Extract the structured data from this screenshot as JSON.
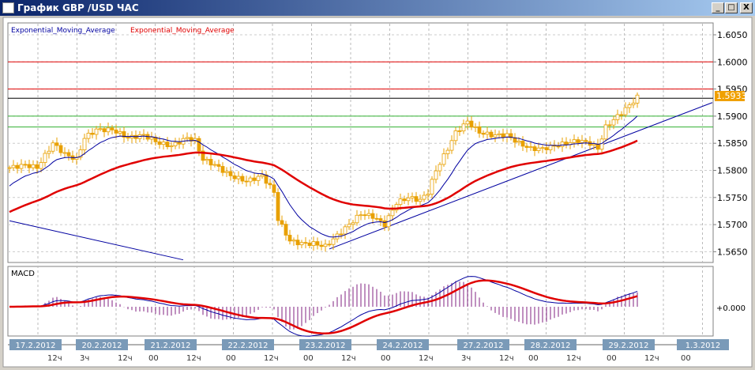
{
  "window": {
    "title": "График GBP /USD  ЧАС",
    "buttons": {
      "minimize": "_",
      "maximize": "□",
      "close": "X"
    }
  },
  "legend": {
    "ema_fast": "Exponential_Moving_Average",
    "ema_slow": "Exponential_Moving_Average"
  },
  "macd_label": "MACD",
  "macd_zero_label": "+0.000",
  "current_price": "1.5933",
  "colors": {
    "candle": "#e8a000",
    "ema_fast": "#0000a0",
    "ema_slow": "#e00000",
    "price_tag": "#f0a000",
    "date_label": "#7a9ab8"
  },
  "chart_data": {
    "type": "candlestick",
    "title": "График GBP /USD  ЧАС",
    "y_ticks": [
      "1.6050",
      "1.6000",
      "1.5950",
      "1.5900",
      "1.5850",
      "1.5800",
      "1.5750",
      "1.5700",
      "1.5650"
    ],
    "ylim": [
      1.5635,
      1.6065
    ],
    "closes_anchor_bar": [
      0,
      4,
      7,
      11,
      14,
      17,
      19,
      22,
      26,
      30,
      34,
      38,
      41,
      45,
      47,
      49,
      52,
      56,
      60,
      64,
      67,
      68,
      71,
      74,
      77,
      80,
      83,
      86,
      89,
      92,
      95,
      98,
      101,
      104,
      106,
      108,
      111,
      113,
      116,
      119,
      122,
      126,
      129,
      132,
      135,
      138,
      141,
      144,
      147,
      149,
      151,
      154,
      157,
      159
    ],
    "closes": [
      1.5805,
      1.581,
      1.5805,
      1.585,
      1.583,
      1.582,
      1.586,
      1.5875,
      1.5875,
      1.586,
      1.5865,
      1.585,
      1.5845,
      1.586,
      1.5855,
      1.582,
      1.581,
      1.579,
      1.578,
      1.579,
      1.576,
      1.571,
      1.567,
      1.5665,
      1.5665,
      1.566,
      1.568,
      1.57,
      1.572,
      1.5715,
      1.57,
      1.574,
      1.575,
      1.5745,
      1.576,
      1.58,
      1.584,
      1.587,
      1.589,
      1.587,
      1.5865,
      1.5865,
      1.585,
      1.584,
      1.584,
      1.5845,
      1.585,
      1.5855,
      1.585,
      1.584,
      1.588,
      1.59,
      1.592,
      1.5935
    ],
    "horizontal_lines": [
      {
        "price": 1.6,
        "color": "#e00000"
      },
      {
        "price": 1.595,
        "color": "#e00000"
      },
      {
        "price": 1.5933,
        "color": "#000000"
      },
      {
        "price": 1.59,
        "color": "#30b030"
      },
      {
        "price": 1.588,
        "color": "#30b030"
      }
    ],
    "trendlines": [
      {
        "from": [
          0,
          1.5707
        ],
        "to": [
          44,
          1.5635
        ]
      },
      {
        "from": [
          81,
          1.5655
        ],
        "to": [
          178,
          1.5925
        ]
      }
    ],
    "ema_periods": {
      "fast": 12,
      "slow": 50
    },
    "dates": [
      "17.2.2012",
      "20.2.2012",
      "21.2.2012",
      "22.2.2012",
      "23.2.2012",
      "24.2.2012",
      "27.2.2012",
      "28.2.2012",
      "29.2.2012",
      "1.3.2012"
    ],
    "hour_labels": [
      [
        "12ч"
      ],
      [
        "3ч",
        "12ч"
      ],
      [
        "00",
        "12ч"
      ],
      [
        "00",
        "12ч"
      ],
      [
        "00",
        "12ч"
      ],
      [
        "00",
        "12ч"
      ],
      [
        "3ч",
        "12ч"
      ],
      [
        "00",
        "12ч"
      ],
      [
        "00",
        "12ч"
      ],
      [
        "00"
      ]
    ]
  }
}
